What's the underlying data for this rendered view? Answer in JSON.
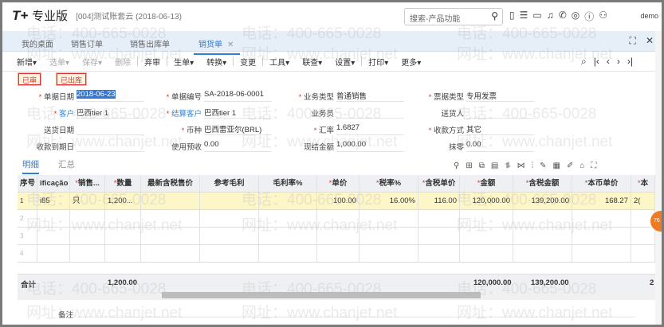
{
  "header": {
    "logo_mark": "T+",
    "logo_text": "专业版",
    "account": "[004]测试账套云  (2018-06-13)",
    "search_placeholder": "搜索-产品功能",
    "user": "demo"
  },
  "tabs": [
    {
      "label": "我的桌面"
    },
    {
      "label": "销售订单"
    },
    {
      "label": "销售出库单"
    },
    {
      "label": "销货单",
      "active": true
    }
  ],
  "toolbar": [
    "新增▾",
    "选单▾",
    "保存▾",
    "删除",
    "弃审",
    "生单▾",
    "转换▾",
    "变更",
    "工具▾",
    "联查▾",
    "设置▾",
    "打印▾",
    "更多▾"
  ],
  "badges": [
    "已审",
    "已出库"
  ],
  "form": {
    "doc_date_label": "单据日期",
    "doc_date": "2018-06-23",
    "doc_no_label": "单据编号",
    "doc_no": "SA-2018-06-0001",
    "biz_type_label": "业务类型",
    "biz_type": "普通销售",
    "invoice_type_label": "票据类型",
    "invoice_type": "专用发票",
    "customer_label": "客户",
    "customer": "巴西tier 1",
    "settle_customer_label": "结算客户",
    "settle_customer": "巴西tier 1",
    "salesman_label": "业务员",
    "salesman": "",
    "deliverer_label": "送货人",
    "deliverer": "",
    "delivery_date_label": "送货日期",
    "delivery_date": "",
    "currency_label": "币种",
    "currency": "巴西雷亚尔(BRL)",
    "rate_label": "汇率",
    "rate": "1.6827",
    "pay_method_label": "收款方式",
    "pay_method": "其它",
    "due_date_label": "收款到期日",
    "due_date": "",
    "prepay_label": "使用预收",
    "prepay": "0.00",
    "cash_label": "现结金额",
    "cash": "1,000.00",
    "discount_label": "抹零",
    "discount": "0.00"
  },
  "detail_tabs": [
    "明细",
    "汇总"
  ],
  "table": {
    "headers": [
      "序号",
      "ificação",
      "销售...",
      "数量",
      "最新含税售价",
      "参考毛利",
      "毛利率%",
      "单价",
      "税率%",
      "含税单价",
      "金额",
      "含税金额",
      "本币单价",
      "本"
    ],
    "rows": [
      [
        "1",
        "i85",
        "只",
        "1,200...",
        "",
        "",
        "",
        "100.00",
        "16.00%",
        "116.00",
        "120,000.00",
        "139,200.00",
        "168.27",
        "2("
      ],
      [
        "2",
        "",
        "",
        "",
        "",
        "",
        "",
        "",
        "",
        "",
        "",
        "",
        "",
        ""
      ],
      [
        "3",
        "",
        "",
        "",
        "",
        "",
        "",
        "",
        "",
        "",
        "",
        "",
        "",
        ""
      ],
      [
        "4",
        "",
        "",
        "",
        "",
        "",
        "",
        "",
        "",
        "",
        "",
        "",
        "",
        ""
      ]
    ],
    "total_label": "合计",
    "total_qty": "1,200.00",
    "total_amount": "120,000.00",
    "total_tax_amount": "139,200.00",
    "total_more": "2"
  },
  "remark_label": "备注",
  "watermark": {
    "phone": "电话：400-665-0028",
    "site": "网址：www.chanjet.net"
  },
  "floating_badge": "76"
}
